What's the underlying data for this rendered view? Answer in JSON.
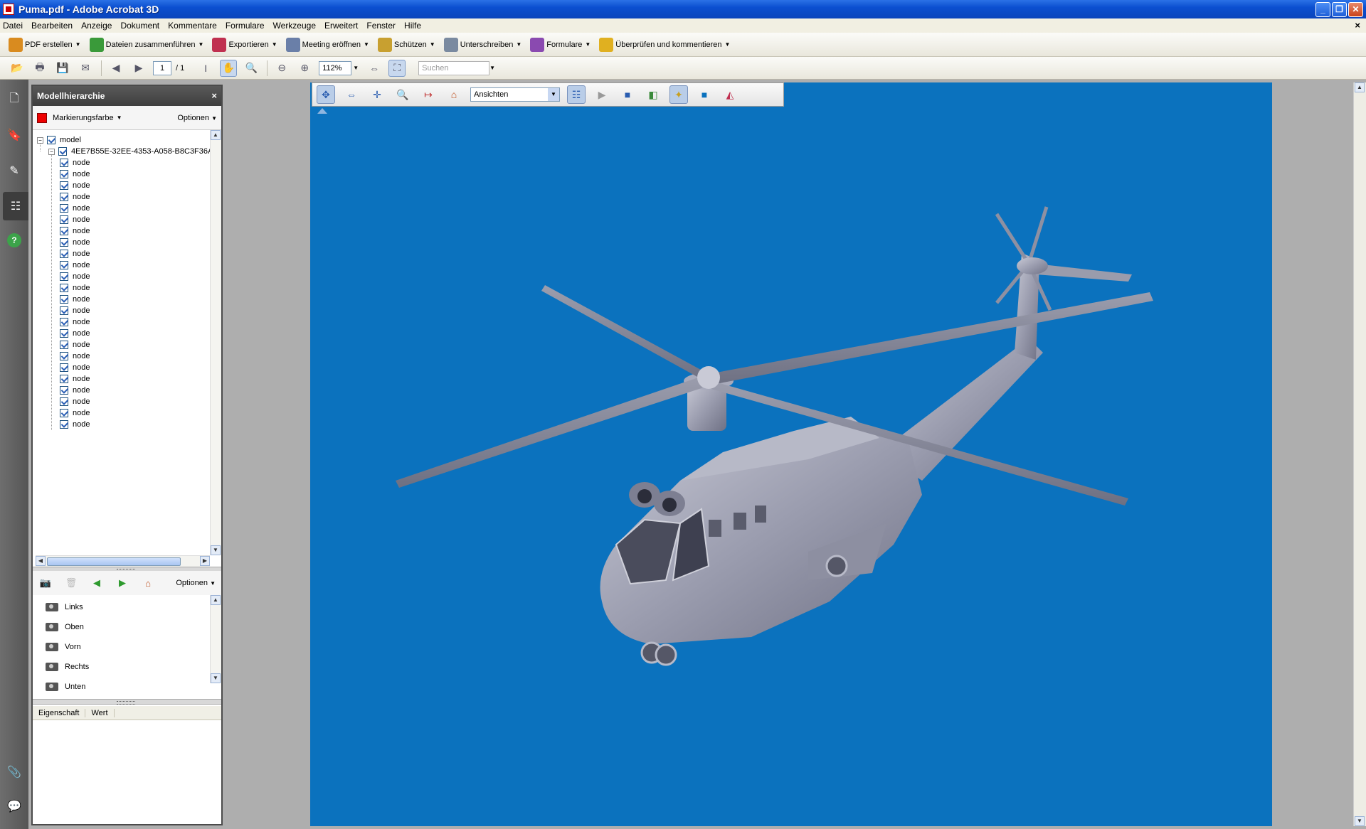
{
  "window": {
    "title": "Puma.pdf - Adobe Acrobat 3D"
  },
  "menu": [
    "Datei",
    "Bearbeiten",
    "Anzeige",
    "Dokument",
    "Kommentare",
    "Formulare",
    "Werkzeuge",
    "Erweitert",
    "Fenster",
    "Hilfe"
  ],
  "tasks": [
    {
      "label": "PDF erstellen",
      "color": "#d98b1f"
    },
    {
      "label": "Dateien zusammenführen",
      "color": "#3a9a3a"
    },
    {
      "label": "Exportieren",
      "color": "#c03050"
    },
    {
      "label": "Meeting eröffnen",
      "color": "#6a7fa8"
    },
    {
      "label": "Schützen",
      "color": "#c8a030"
    },
    {
      "label": "Unterschreiben",
      "color": "#7a8aa0"
    },
    {
      "label": "Formulare",
      "color": "#8a4ab0"
    },
    {
      "label": "Überprüfen und kommentieren",
      "color": "#e0b020"
    }
  ],
  "toolbar": {
    "page_current": "1",
    "page_total": "/ 1",
    "zoom": "112%",
    "search_placeholder": "Suchen"
  },
  "model_panel": {
    "title": "Modellhierarchie",
    "close": "×",
    "highlight_label": "Markierungsfarbe",
    "highlight_color": "#e00000",
    "options_label": "Optionen",
    "root": "model",
    "group": "4EE7B55E-32EE-4353-A058-B8C3F36A",
    "nodes": [
      "node",
      "node",
      "node",
      "node",
      "node",
      "node",
      "node",
      "node",
      "node",
      "node",
      "node",
      "node",
      "node",
      "node",
      "node",
      "node",
      "node",
      "node",
      "node",
      "node",
      "node",
      "node",
      "node",
      "node"
    ]
  },
  "views_panel": {
    "options_label": "Optionen",
    "views": [
      "Links",
      "Oben",
      "Vorn",
      "Rechts",
      "Unten"
    ]
  },
  "properties": {
    "col_property": "Eigenschaft",
    "col_value": "Wert"
  },
  "viewer3d": {
    "views_dropdown": "Ansichten",
    "background_color": "#0b72be"
  }
}
